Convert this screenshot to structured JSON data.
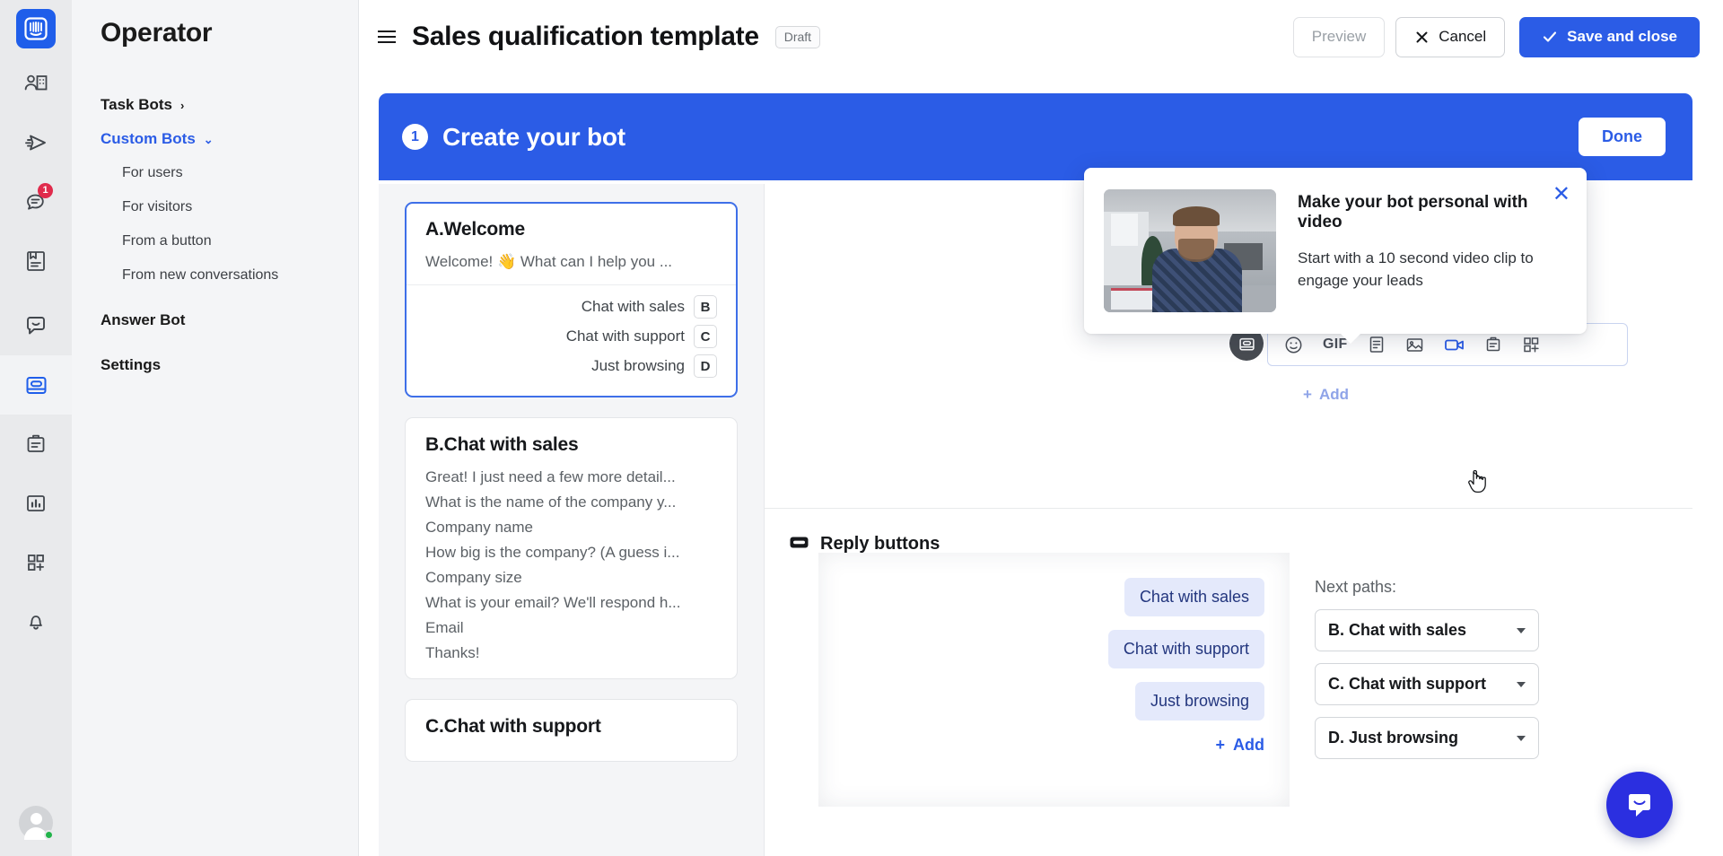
{
  "rail": {
    "logo": "intercom-logo-icon",
    "items": [
      {
        "name": "contacts-icon",
        "badge": null
      },
      {
        "name": "send-message-icon",
        "badge": null
      },
      {
        "name": "conversations-icon",
        "badge": "1"
      },
      {
        "name": "articles-icon",
        "badge": null
      },
      {
        "name": "messenger-icon",
        "badge": null
      },
      {
        "name": "operator-bots-icon",
        "badge": null
      },
      {
        "name": "outbound-icon",
        "badge": null
      },
      {
        "name": "reports-icon",
        "badge": null
      },
      {
        "name": "apps-icon",
        "badge": null
      },
      {
        "name": "notifications-bell-icon",
        "badge": null
      }
    ]
  },
  "sidebar": {
    "title": "Operator",
    "task_bots": "Task Bots",
    "custom_bots": "Custom Bots",
    "sub_items": [
      "For users",
      "For visitors",
      "From a button",
      "From new conversations"
    ],
    "answer_bot": "Answer Bot",
    "settings": "Settings"
  },
  "topbar": {
    "title": "Sales qualification template",
    "status": "Draft",
    "preview": "Preview",
    "cancel": "Cancel",
    "save": "Save and close"
  },
  "banner": {
    "step": "1",
    "title": "Create your bot",
    "done": "Done"
  },
  "cards": [
    {
      "title": "A.Welcome",
      "lines": [
        "Welcome! 👋 What can I help you ..."
      ],
      "replies": [
        {
          "label": "Chat with sales",
          "key": "B"
        },
        {
          "label": "Chat with support",
          "key": "C"
        },
        {
          "label": "Just browsing",
          "key": "D"
        }
      ],
      "selected": true
    },
    {
      "title": "B.Chat with sales",
      "lines": [
        "Great! I just need a few more detail...",
        "What is the name of the company y...",
        "Company name",
        "How big is the company? (A guess i...",
        "Company size",
        "What is your email? We'll respond h...",
        "Email",
        "Thanks!"
      ],
      "replies": [],
      "selected": false
    },
    {
      "title": "C.Chat with support",
      "lines": [],
      "replies": [],
      "selected": false
    }
  ],
  "composer": {
    "tools": [
      {
        "name": "emoji-icon",
        "label": ""
      },
      {
        "name": "gif-icon",
        "label": "GIF"
      },
      {
        "name": "article-icon",
        "label": ""
      },
      {
        "name": "image-icon",
        "label": ""
      },
      {
        "name": "video-icon",
        "label": ""
      },
      {
        "name": "clipboard-icon",
        "label": ""
      },
      {
        "name": "app-add-icon",
        "label": ""
      }
    ],
    "add_label": "Add"
  },
  "popup": {
    "title": "Make your bot personal with video",
    "body": "Start with a 10 second video clip to engage your leads",
    "close": "✕"
  },
  "replies_section": {
    "title": "Reply buttons",
    "chips": [
      "Chat with sales",
      "Chat with support",
      "Just browsing"
    ],
    "add_label": "Add",
    "next_paths_label": "Next paths:",
    "next_paths": [
      "B. Chat with sales",
      "C. Chat with support",
      "D. Just browsing"
    ]
  },
  "colors": {
    "accent": "#2b5ce6",
    "banner": "#2b5ce6",
    "badge": "#e02b4c",
    "chip_bg": "#e4e9fb",
    "bubble": "#2b2fe0"
  }
}
